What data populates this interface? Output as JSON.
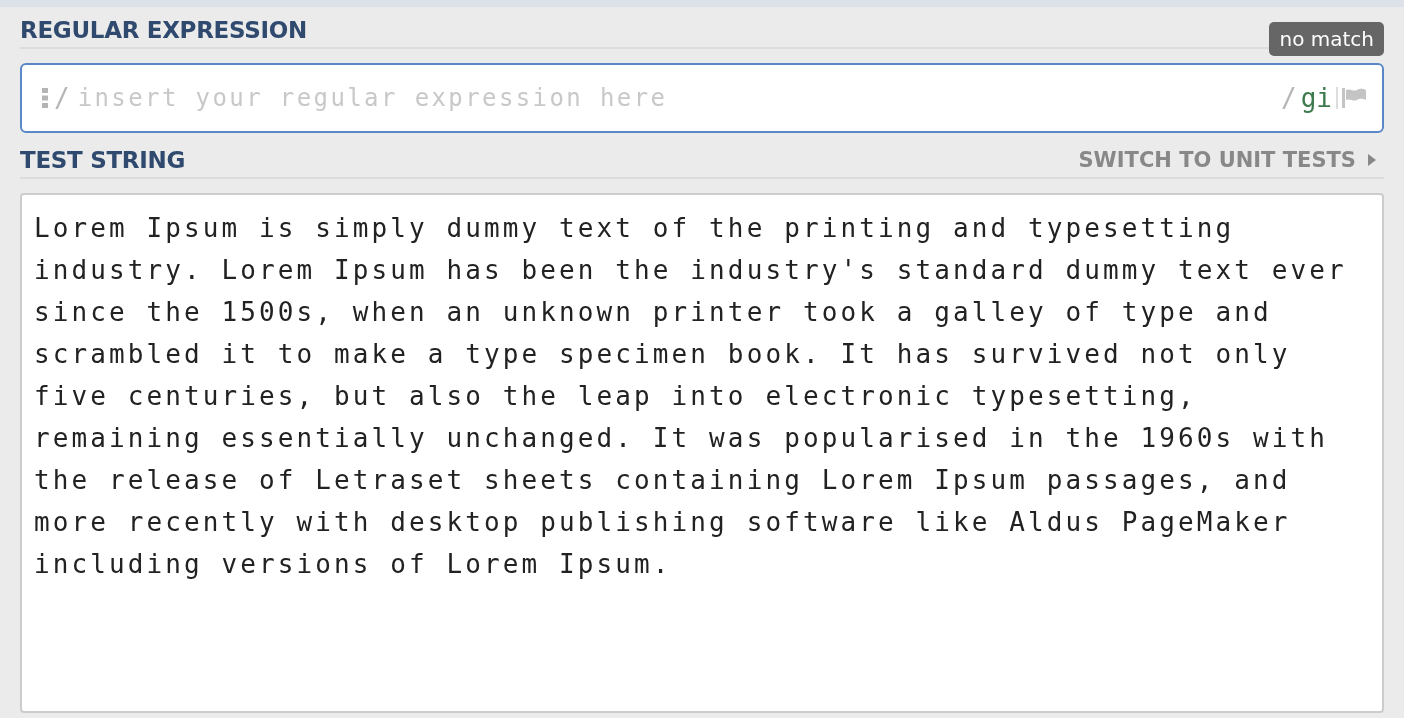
{
  "regex": {
    "title": "REGULAR EXPRESSION",
    "status": "no match",
    "delimiter": "/",
    "placeholder": "insert your regular expression here",
    "closing_delimiter": "/",
    "flags": "gi"
  },
  "test_string": {
    "title": "TEST STRING",
    "switch_link": "SWITCH TO UNIT TESTS",
    "value": "Lorem Ipsum is simply dummy text of the printing and typesetting industry. Lorem Ipsum has been the industry's standard dummy text ever since the 1500s, when an unknown printer took a galley of type and scrambled it to make a type specimen book. It has survived not only five centuries, but also the leap into electronic typesetting, remaining essentially unchanged. It was popularised in the 1960s with the release of Letraset sheets containing Lorem Ipsum passages, and more recently with desktop publishing software like Aldus PageMaker including versions of Lorem Ipsum."
  }
}
